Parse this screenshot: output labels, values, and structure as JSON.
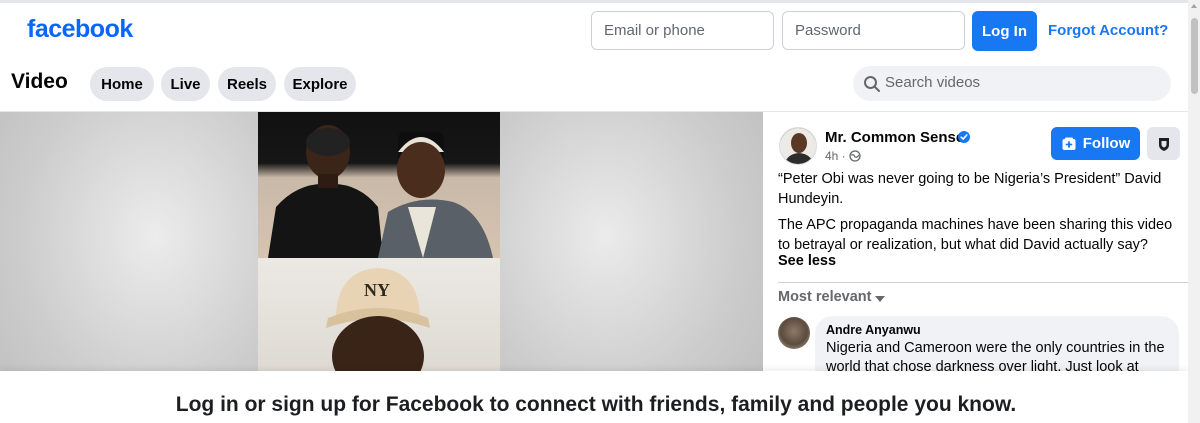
{
  "header": {
    "logo": "facebook",
    "email_placeholder": "Email or phone",
    "password_placeholder": "Password",
    "login_label": "Log In",
    "forgot_label": "Forgot Account?"
  },
  "subnav": {
    "title": "Video",
    "tabs": [
      {
        "label": "Home"
      },
      {
        "label": "Live"
      },
      {
        "label": "Reels"
      },
      {
        "label": "Explore"
      }
    ],
    "search_placeholder": "Search videos"
  },
  "post": {
    "author": "Mr. Common Sense",
    "time": "4h ·",
    "follow_label": "Follow",
    "paragraph1": "“Peter Obi was never going to be Nigeria’s President” David Hundeyin.",
    "paragraph2": "The APC propaganda machines have been sharing this video to betrayal or realization, but what did David actually say?",
    "see_less": "See less",
    "sort_label": "Most relevant"
  },
  "comments": [
    {
      "name": "Andre Anyanwu",
      "text": "Nigeria and Cameroon were the only countries in the world that chose darkness over light. Just look at"
    }
  ],
  "banner": {
    "text": "Log in or sign up for Facebook to connect with friends, family and people you know."
  },
  "video": {
    "cap_text": "NY"
  },
  "colors": {
    "brand": "#0866ff",
    "button": "#1877f2",
    "pill_bg": "#e4e6eb"
  }
}
